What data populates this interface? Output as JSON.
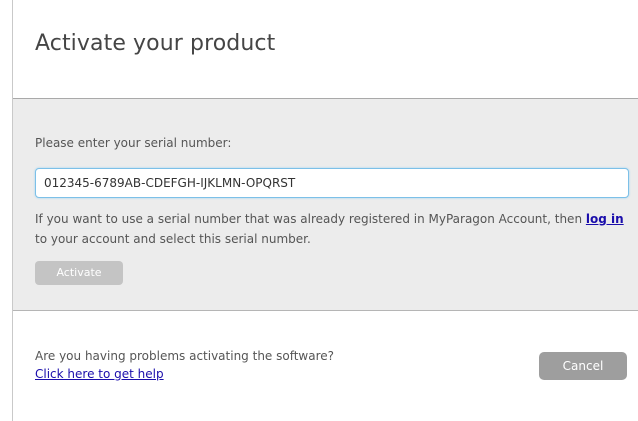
{
  "dialog": {
    "title": "Activate your product"
  },
  "activation": {
    "prompt": "Please enter your serial number:",
    "serial_value": "012345-6789AB-CDEFGH-IJKLMN-OPQRST",
    "info_before": "If you want to use a serial number that was already registered in MyParagon Account, then ",
    "login_link": "log in",
    "info_after": " to your account and select this serial number.",
    "activate_label": "Activate"
  },
  "footer": {
    "question": "Are you having problems activating the software?",
    "help_link": "Click here to get help",
    "cancel_label": "Cancel"
  },
  "colors": {
    "content_background": "#ececec",
    "input_focus_border": "#7cc0e8",
    "link": "#1a0dab",
    "disabled_button": "#c4c4c4",
    "cancel_button": "#9e9e9e"
  }
}
